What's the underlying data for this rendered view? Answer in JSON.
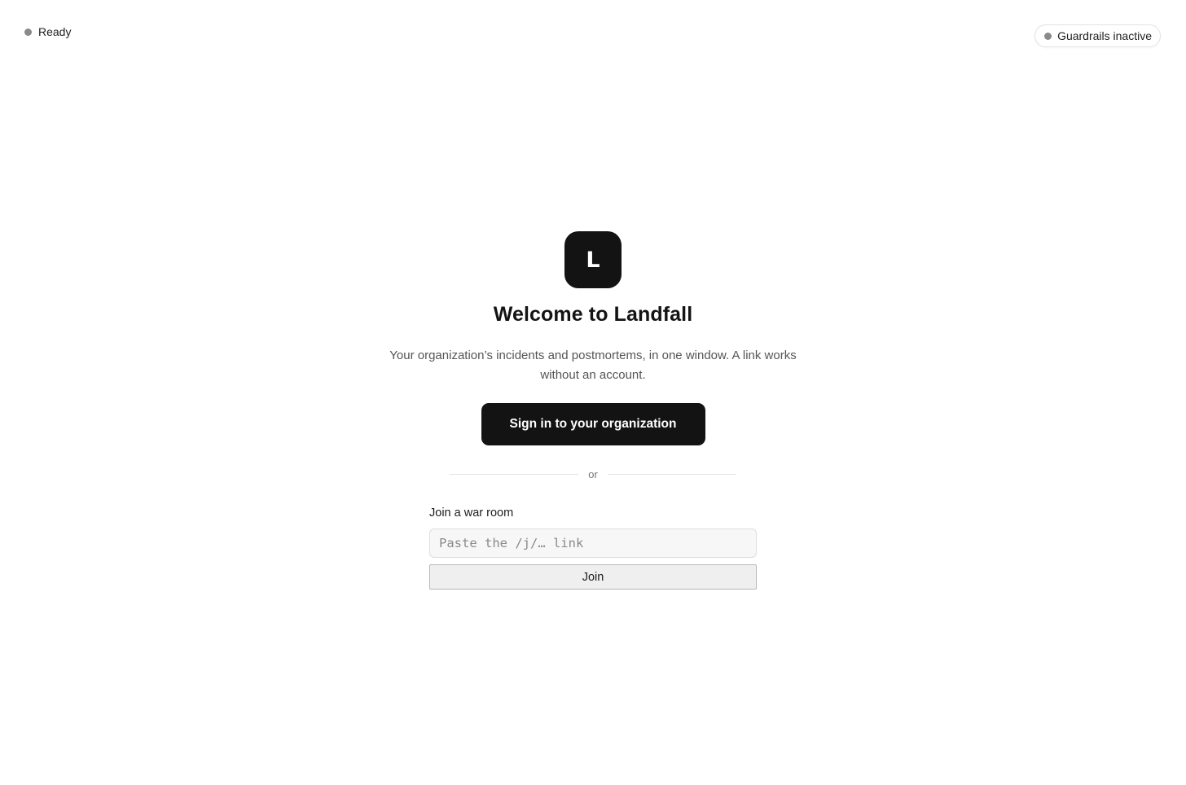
{
  "status": {
    "label": "Ready",
    "dot_color": "#8a8a8a"
  },
  "guardrails": {
    "label": "Guardrails inactive",
    "dot_color": "#8a8a8a"
  },
  "brand": {
    "logo_letter": "L",
    "logo_color": "#131313"
  },
  "welcome": {
    "title": "Welcome to Landfall",
    "subtitle": "Your organization’s incidents and postmortems, in one window. A link works without an account.",
    "signin_label": "Sign in to your organization"
  },
  "divider": {
    "label": "or"
  },
  "join": {
    "label": "Join a war room",
    "placeholder": "Paste the /j/… link",
    "value": "",
    "button_label": "Join"
  }
}
